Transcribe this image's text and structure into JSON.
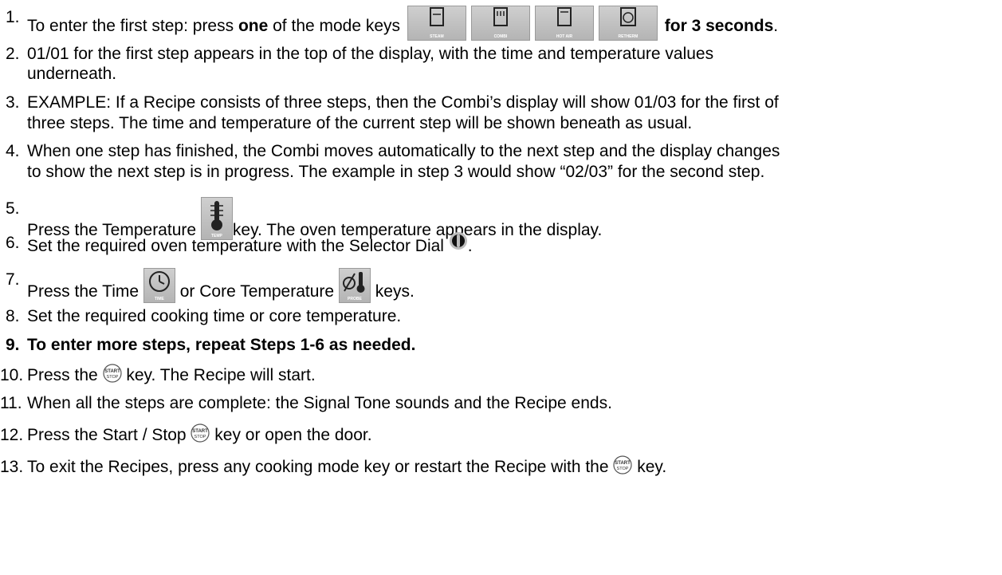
{
  "steps": [
    {
      "num": "1.",
      "a": "To enter the first step: press ",
      "b": "one",
      "c": " of the mode keys",
      "d": "for 3 seconds",
      "e": "."
    },
    {
      "num": "2.",
      "line1": "01/01 for the first step appears in the top of the display, with the time and temperature values",
      "line2": "underneath."
    },
    {
      "num": "3.",
      "line1": "EXAMPLE: If a Recipe consists of three steps, then the Combi’s display will show 01/03 for the first of",
      "line2": "three steps. The time and temperature of the current step will be shown beneath as usual."
    },
    {
      "num": "4.",
      "line1": "When one step has finished, the Combi moves automatically to the next step and the display changes",
      "line2": "to show the next step is in progress. The example in step 3 would show “02/03” for the second step."
    },
    {
      "num": "5.",
      "a": "Press the Temperature ",
      "b": "key. The oven temperature appears in the display."
    },
    {
      "num": "6.",
      "a": "Set the required oven temperature with the Selector Dial ",
      "b": "."
    },
    {
      "num": "7.",
      "a": "Press the Time ",
      "b": " or Core Temperature ",
      "c": " keys."
    },
    {
      "num": "8.",
      "text": "Set the required cooking time or core temperature."
    },
    {
      "num": "9.",
      "text": "To enter more steps, repeat Steps 1-6 as needed."
    },
    {
      "num": "10.",
      "a": "Press the ",
      "b": " key. The Recipe will start."
    },
    {
      "num": "11.",
      "text": "When all the steps are complete: the Signal Tone sounds and the Recipe ends."
    },
    {
      "num": "12.",
      "a": "Press the Start / Stop ",
      "b": " key or open the door."
    },
    {
      "num": "13.",
      "a": "To exit the Recipes, press any cooking mode key or restart the Recipe with the ",
      "b": " key."
    }
  ],
  "keys": {
    "steam": "STEAM",
    "combi": "COMBI",
    "hot_air": "HOT AIR",
    "retherm": "RETHERM",
    "temp": "TEMP",
    "time": "TIME",
    "probe": "PROBE",
    "start": "START",
    "stop": "STOP"
  }
}
